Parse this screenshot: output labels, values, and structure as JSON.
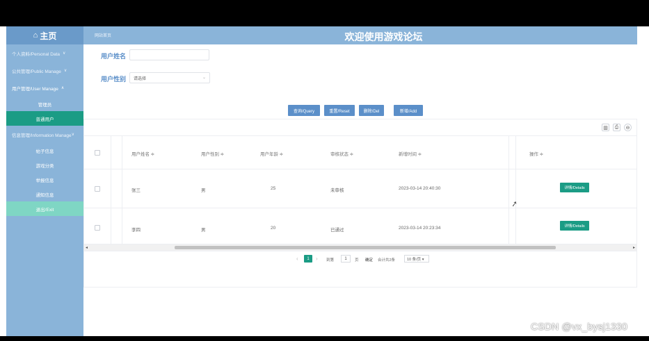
{
  "header": {
    "home_icon": "home-icon",
    "home_label": "主页",
    "breadcrumb": "网站首页",
    "title": "欢迎使用游戏论坛"
  },
  "sidebar": {
    "menus": [
      {
        "label": "个人资料/Personal Data",
        "chevron": "∨"
      },
      {
        "label": "公共管理/Public Manage",
        "chevron": "∨"
      },
      {
        "label": "用户管理/User Manage",
        "chevron": "∧"
      }
    ],
    "user_sub": [
      "管理员",
      "普通用户"
    ],
    "info_menu": {
      "label": "信息管理/Information Manage",
      "chevron": "∨"
    },
    "info_sub": [
      "帖子信息",
      "游戏分类",
      "举报信息",
      "通知信息"
    ],
    "exit": "退出/Exit",
    "active_color": "#1b9c85"
  },
  "filters": {
    "name_label": "用户姓名",
    "name_value": "",
    "gender_label": "用户性别",
    "gender_placeholder": "请选择"
  },
  "actions": {
    "query": "查询/Query",
    "reset": "重置/Reset",
    "delete": "删除/Del",
    "add": "新增/Add"
  },
  "toolbar_icons": [
    "columns-icon",
    "print-icon",
    "export-icon"
  ],
  "table": {
    "headers": [
      "用户姓名 ≑",
      "用户性别 ≑",
      "用户年龄 ≑",
      "审核状态 ≑",
      "新增时间 ≑",
      "操作 ≑"
    ],
    "rows": [
      {
        "name": "张三",
        "gender": "男",
        "age": "25",
        "status": "未审核",
        "time": "2023-03-14 20:40:30",
        "action": "详情/Details"
      },
      {
        "name": "李四",
        "gender": "男",
        "age": "20",
        "status": "已通过",
        "time": "2023-03-14 20:23:34",
        "action": "详情/Details"
      }
    ]
  },
  "pagination": {
    "prev": "‹",
    "current": "1",
    "next": "›",
    "goto_label": "到第",
    "goto_value": "1",
    "page_unit": "页",
    "confirm": "确定",
    "total": "合计共2条",
    "page_size": "10 条/页 ▾"
  },
  "watermark": "CSDN @vx_bysj1330"
}
